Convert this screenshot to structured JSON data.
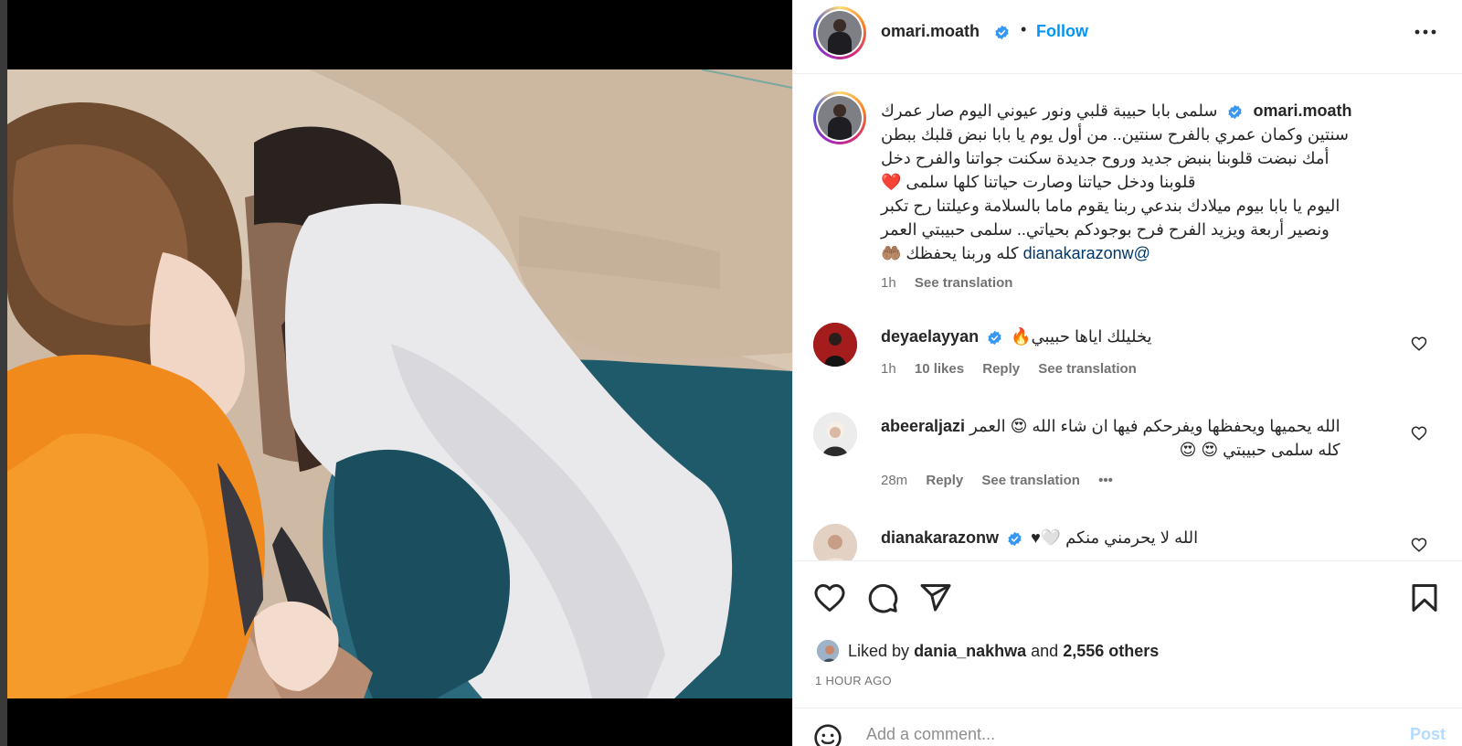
{
  "post": {
    "username": "omari.moath",
    "follow_label": "Follow",
    "separator": "•"
  },
  "caption": {
    "username": "omari.moath",
    "lines": [
      "سلمى بابا حبيبة قلبي ونور عيوني اليوم صار عمرك",
      "سنتين وكمان عمري بالفرح سنتين.. من أول يوم يا بابا نبض قلبك ببطن",
      "أمك نبضت قلوبنا بنبض جديد وروح جديدة سكنت جواتنا والفرح دخل",
      "قلوبنا ودخل حياتنا وصارت حياتنا كلها سلمى ❤️",
      "اليوم يا بابا بيوم ميلادك بندعي ربنا يقوم ماما بالسلامة وعيلتنا رح تكبر",
      "ونصير أربعة ويزيد الفرح فرح بوجودكم بحياتي.. سلمى حبيبتي العمر",
      "كله وربنا يحفظك 🤲🏽"
    ],
    "mention": "@dianakarazonw",
    "time": "1h",
    "see_translation": "See translation"
  },
  "comments": [
    {
      "username": "deyaelayyan",
      "verified": true,
      "lines": [
        "يخليلك اياها حبيبي🔥"
      ],
      "time": "1h",
      "likes": "10 likes",
      "reply": "Reply",
      "see_translation": "See translation"
    },
    {
      "username": "abeeraljazi",
      "verified": false,
      "lines": [
        "الله يحميها ويحفظها ويفرحكم فيها ان شاء الله 😍 العمر",
        "كله سلمى حبيبتي 😍 😍"
      ],
      "time": "28m",
      "reply": "Reply",
      "see_translation": "See translation",
      "more": "•••"
    },
    {
      "username": "dianakarazonw",
      "verified": true,
      "lines": [
        "الله لا يحرمني منكم 🤍♥"
      ]
    }
  ],
  "likes": {
    "prefix": "Liked by",
    "user": "dania_nakhwa",
    "and": "and",
    "others": "2,556 others"
  },
  "timestamp": "1 HOUR AGO",
  "composer": {
    "placeholder": "Add a comment...",
    "post_label": "Post"
  },
  "colors": {
    "accent": "#0095f6",
    "verified": "#3897f0",
    "post_disabled": "#b3dbff",
    "text": "#262626",
    "muted": "#737373"
  },
  "icons": [
    "verified-icon",
    "more-options-icon",
    "heart-icon",
    "comment-icon",
    "share-icon",
    "bookmark-icon",
    "emoji-icon"
  ]
}
